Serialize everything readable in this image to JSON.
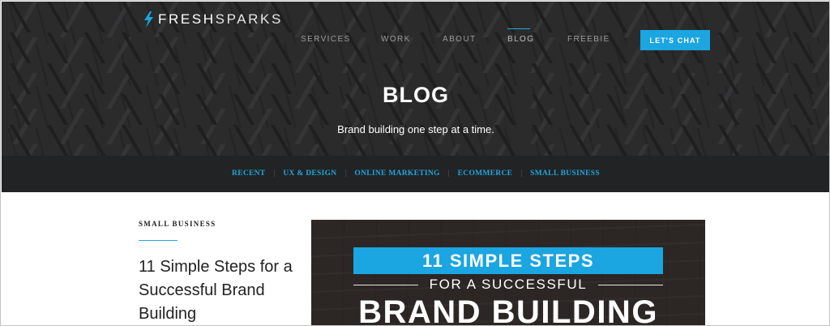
{
  "brand": {
    "logo_bold": "FRESH",
    "logo_light": "SPARKS",
    "logo_icon": "lightning-bolt-icon"
  },
  "nav": {
    "items": [
      {
        "label": "SERVICES",
        "active": false
      },
      {
        "label": "WORK",
        "active": false
      },
      {
        "label": "ABOUT",
        "active": false
      },
      {
        "label": "BLOG",
        "active": true
      },
      {
        "label": "FREEBIE",
        "active": false
      }
    ],
    "cta": "LET'S CHAT"
  },
  "hero": {
    "title": "BLOG",
    "subtitle": "Brand building one step at a time."
  },
  "categories": [
    "RECENT",
    "UX & DESIGN",
    "ONLINE MARKETING",
    "ECOMMERCE",
    "SMALL BUSINESS"
  ],
  "post": {
    "category": "SMALL BUSINESS",
    "title": "11 Simple Steps for a Successful Brand Building",
    "image": {
      "band_text": "11 SIMPLE STEPS",
      "sub_text": "FOR A SUCCESSFUL",
      "big_text": "BRAND BUILDING"
    }
  },
  "colors": {
    "accent": "#1ba5e1",
    "hero_bg": "#2b2b2c",
    "category_bar_bg": "#212324",
    "text_dark": "#222222"
  }
}
